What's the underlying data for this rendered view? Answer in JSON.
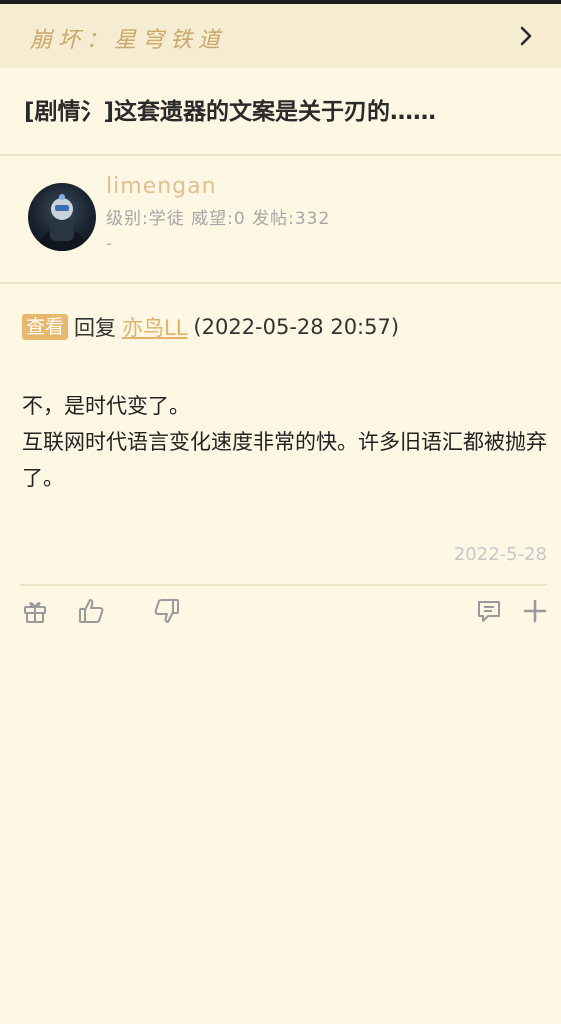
{
  "forum": {
    "name": "崩坏：星穹铁道"
  },
  "thread": {
    "title": "[剧情氵]这套遗器的文案是关于刃的……"
  },
  "author": {
    "username": "limengan",
    "meta": "级别:学徒 威望:0 发帖:332",
    "signature": "-"
  },
  "reply": {
    "view_badge": "查看",
    "reply_word": "回复",
    "reply_user": "亦鸟LL",
    "reply_time": "(2022-05-28 20:57)"
  },
  "post": {
    "lines": [
      "不，是时代变了。",
      "互联网时代语言变化速度非常的快。许多旧语汇都被抛弃了。"
    ],
    "date": "2022-5-28"
  },
  "icons": {
    "gift": "gift-icon",
    "like": "thumbs-up-icon",
    "dislike": "thumbs-down-icon",
    "comment": "comment-icon",
    "more": "plus-icon",
    "next": "chevron-right-icon"
  },
  "colors": {
    "background": "#fdf7e3",
    "accent": "#e2b26a",
    "badge": "#e8b86e"
  }
}
